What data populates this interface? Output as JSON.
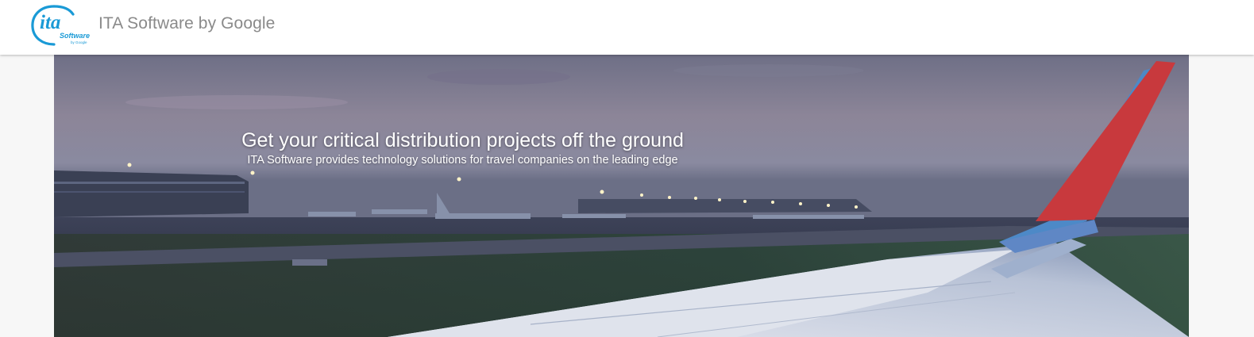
{
  "header": {
    "logo": {
      "main_text": "ita",
      "sub_text": "Software",
      "tiny_text": "by Google",
      "color": "#1a9ad6"
    },
    "title": "ITA Software by Google"
  },
  "hero": {
    "headline": "Get your critical distribution projects off the ground",
    "subheadline": "ITA Software provides technology solutions for travel companies on the leading edge",
    "image_description_icon": "airplane-wing-at-dusk-image"
  },
  "colors": {
    "header_bg": "#ffffff",
    "page_bg": "#f7f7f7",
    "title_text": "#8a8a8a",
    "wing_red": "#c8393d",
    "wing_blue": "#4d89c7"
  }
}
